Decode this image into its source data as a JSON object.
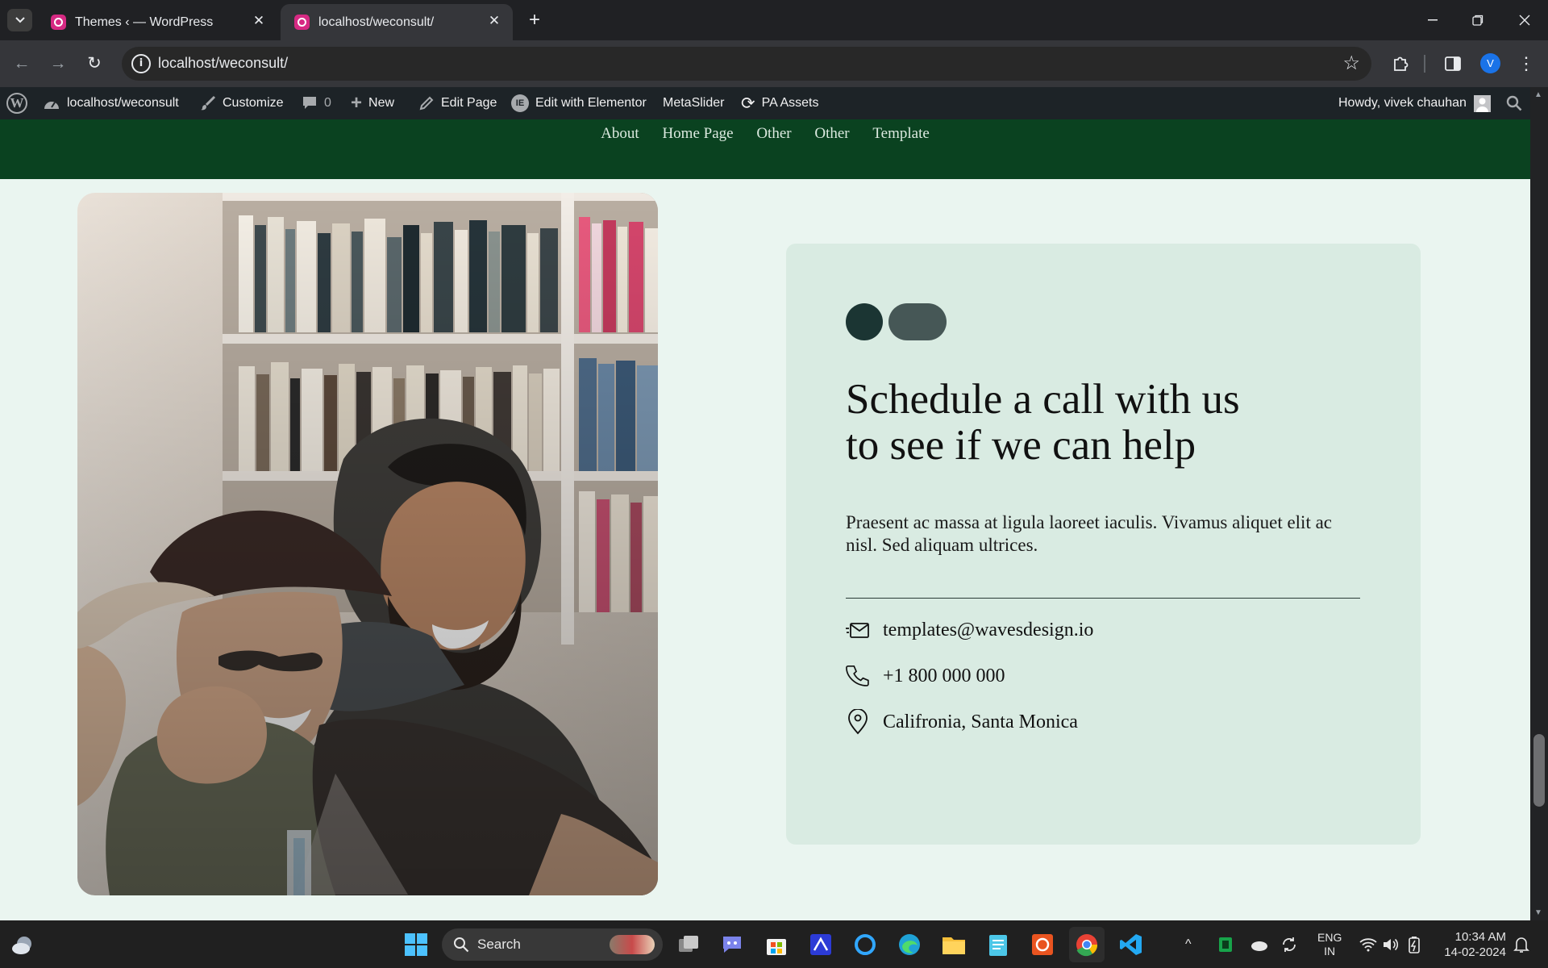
{
  "browser": {
    "tabs": [
      {
        "title": "Themes ‹ — WordPress"
      },
      {
        "title": "localhost/weconsult/"
      }
    ],
    "url": "localhost/weconsult/",
    "profile_initial": "V"
  },
  "admin_bar": {
    "site": "localhost/weconsult",
    "customize": "Customize",
    "comments_count": "0",
    "new": "New",
    "edit_page": "Edit Page",
    "edit_elementor": "Edit with Elementor",
    "metaslider": "MetaSlider",
    "pa_assets": "PA Assets",
    "howdy": "Howdy, vivek chauhan"
  },
  "site_nav": [
    "About",
    "Home Page",
    "Other",
    "Other",
    "Template"
  ],
  "cta": {
    "heading_line1": "Schedule a call with us",
    "heading_line2": "to see if we can help",
    "body": "Praesent ac massa at ligula laoreet iaculis. Vivamus aliquet elit ac nisl. Sed aliquam ultrices.",
    "email": "templates@wavesdesign.io",
    "phone": "+1 800 000 000",
    "location": "Califronia, Santa Monica"
  },
  "taskbar": {
    "search_placeholder": "Search",
    "lang_line1": "ENG",
    "lang_line2": "IN",
    "time": "10:34 AM",
    "date": "14-02-2024"
  },
  "colors": {
    "site_nav_bg": "#0a4220",
    "page_bg": "#eaf5f0",
    "card_bg": "#d9ebe2",
    "admin_bar_bg": "#1d2327"
  }
}
